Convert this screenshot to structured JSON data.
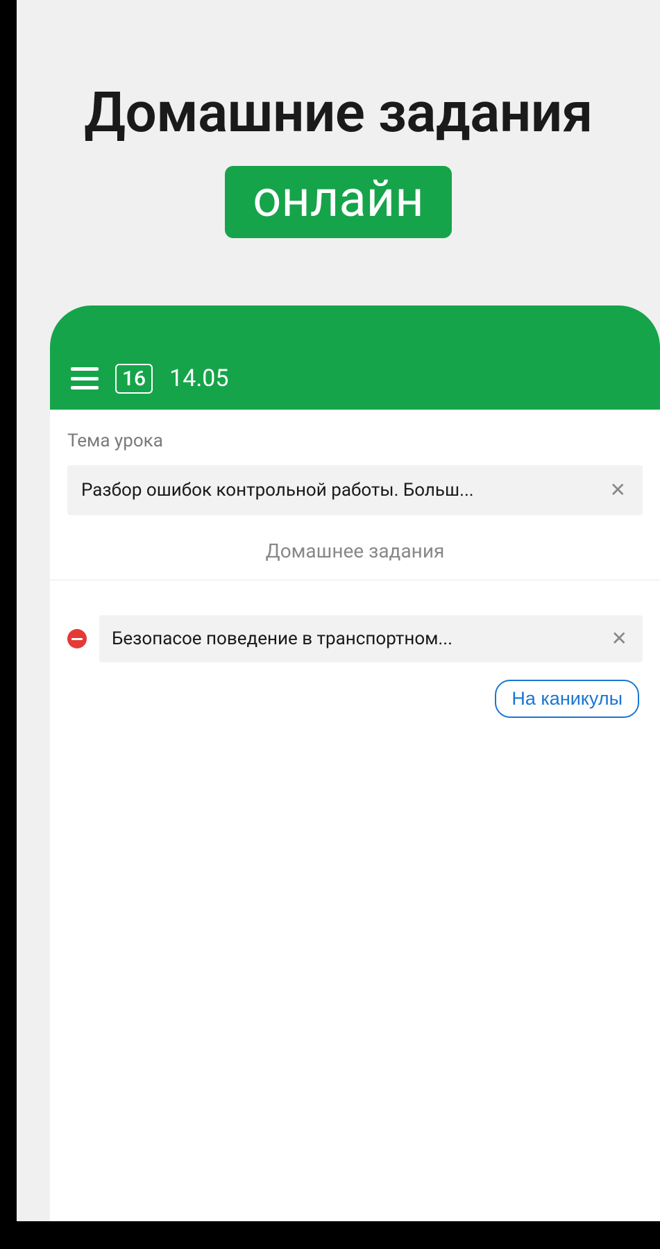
{
  "promo": {
    "title": "Домашние задания",
    "badge": "онлайн"
  },
  "header": {
    "day_box": "16",
    "date": "14.05"
  },
  "main": {
    "topic_label": "Тема урока",
    "topic_value": "Разбор ошибок контрольной работы. Больш...",
    "homework_label": "Домашнее задания",
    "homework_value": "Безопасое поведение в транспортном...",
    "holiday_button": "На каникулы"
  },
  "colors": {
    "accent_green": "#16a44a",
    "accent_blue": "#1976d2",
    "deny_red": "#e53935"
  }
}
